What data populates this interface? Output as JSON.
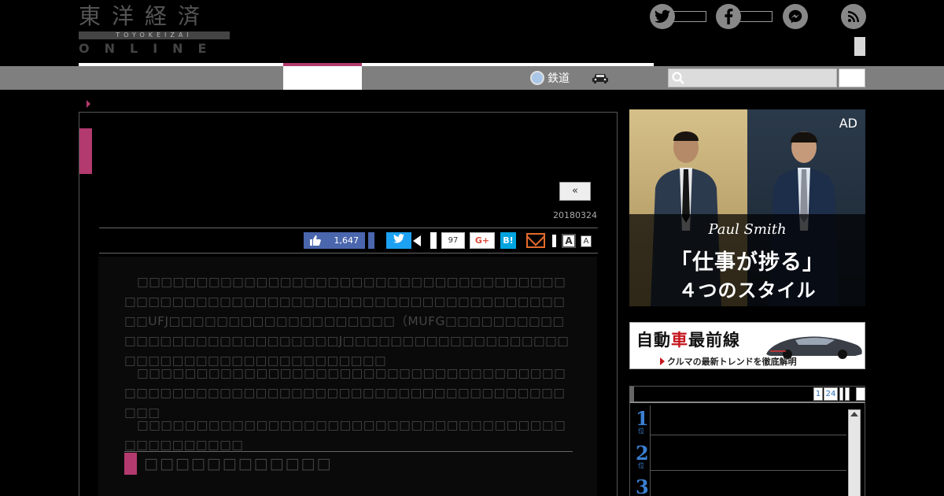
{
  "header": {
    "logo_kanji": "東洋経済",
    "logo_romaji": "TOYOKEIZAI",
    "logo_online": "ONLINE"
  },
  "nav": {
    "rail_label": "鉄道"
  },
  "article": {
    "prev_label": "«",
    "date": "20180324",
    "share": {
      "facebook_count": "1,647",
      "pocket_count": "97",
      "gplus_label": "G+",
      "hatena_label": "B!",
      "font_large": "A",
      "font_small": "A"
    },
    "paragraphs": [
      "　□□□□□□□□□□□□□□□□□□□□□□□□□□□□□□□□□□□□□□□□□□□□□□□□□□□□□□□□□□□□□□□□□□□□□□□□□□□UFJ□□□□□□□□□□□□□□□□□□□（MUFG□□□□□□□□□□□□□□□□□□□□□□□□□□□□J□□□□□□□□□□□□□□□□□□□□□□□□□□□□□□□□□□□□□□□□□",
      "　□□□□□□□□□□□□□□□□□□□□□□□□□□□□□□□□□□□□□□□□□□□□□□□□□□□□□□□□□□□□□□□□□□□□□□□□□□□□",
      "　□□□□□□□□□□□□□□□□□□□□□□□□□□□□□□□□□□□□□□□□□□□□□□"
    ],
    "subheading": "□□□□□□□□□□□□"
  },
  "sidebar": {
    "ad": {
      "tag": "AD",
      "brand": "Paul Smith",
      "copy_line1": "「仕事が捗る」",
      "copy_line2": "４つのスタイル"
    },
    "banner": {
      "title_a": "自動",
      "title_b": "車",
      "title_c": "最前線",
      "subtitle": "クルマの最新トレンドを徹底解明"
    },
    "ranking": {
      "tabs": [
        "1",
        "24"
      ],
      "ranks": [
        "1",
        "2",
        "3"
      ],
      "unit": "位"
    }
  },
  "colors": {
    "accent": "#b23a6e",
    "nav_gray": "#7f7f7f",
    "rank_blue": "#3a7fd0"
  }
}
